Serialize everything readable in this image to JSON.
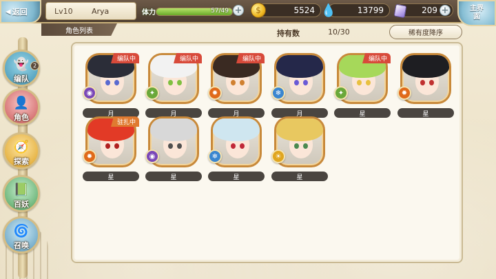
{
  "header": {
    "back_label": "返回",
    "level": "Lv10",
    "username": "Arya",
    "stamina_label": "体力",
    "stamina_value": "57/49",
    "stamina_fraction": 1.0,
    "coins": "5524",
    "gems": "13799",
    "crystals": "209",
    "main_label": "主界面"
  },
  "subheader": {
    "tab_title": "角色列表",
    "owned_label": "持有数",
    "owned_count": "10/30",
    "sort_label": "稀有度降序"
  },
  "nav": {
    "items": [
      {
        "label": "编队",
        "badge": "2",
        "icon": "cat-ghost-icon",
        "active": true
      },
      {
        "label": "角色",
        "icon": "character-icon"
      },
      {
        "label": "探索",
        "icon": "compass-icon"
      },
      {
        "label": "百妖",
        "icon": "yokai-book-icon"
      },
      {
        "label": "召唤",
        "icon": "summon-swirl-icon"
      }
    ]
  },
  "characters": [
    {
      "rank": "月",
      "status": "编队中",
      "element": "dark",
      "hair": "#2b2d38",
      "eyes": "#5a6ad0"
    },
    {
      "rank": "月",
      "status": "编队中",
      "element": "wind",
      "hair": "#f2f2f2",
      "eyes": "#7fc040"
    },
    {
      "rank": "月",
      "status": "编队中",
      "element": "fire",
      "hair": "#3a2a22",
      "eyes": "#d08030"
    },
    {
      "rank": "月",
      "status": "",
      "element": "water",
      "hair": "#25284a",
      "eyes": "#6a5ad6"
    },
    {
      "rank": "星",
      "status": "编队中",
      "element": "wind",
      "hair": "#a6d85a",
      "eyes": "#e8c040"
    },
    {
      "rank": "星",
      "status": "",
      "element": "fire",
      "hair": "#1e1e22",
      "eyes": "#c03030"
    },
    {
      "rank": "星",
      "status": "驻扎中",
      "element": "fire",
      "hair": "#e23a26",
      "eyes": "#b02020"
    },
    {
      "rank": "星",
      "status": "",
      "element": "dark",
      "hair": "#d8d8d8",
      "eyes": "#505050"
    },
    {
      "rank": "星",
      "status": "",
      "element": "water",
      "hair": "#cfe6f0",
      "eyes": "#c02838"
    },
    {
      "rank": "星",
      "status": "",
      "element": "light",
      "hair": "#e8c860",
      "eyes": "#4a8a50"
    }
  ],
  "colors": {
    "status_red": "#d84a3a",
    "status_orange": "#e07a30",
    "element_dark": "#7a48b8",
    "element_wind": "#6aa83a",
    "element_fire": "#e06a1a",
    "element_water": "#3a86d0",
    "element_light": "#e0a620",
    "frame_orange": "#c8893a"
  }
}
